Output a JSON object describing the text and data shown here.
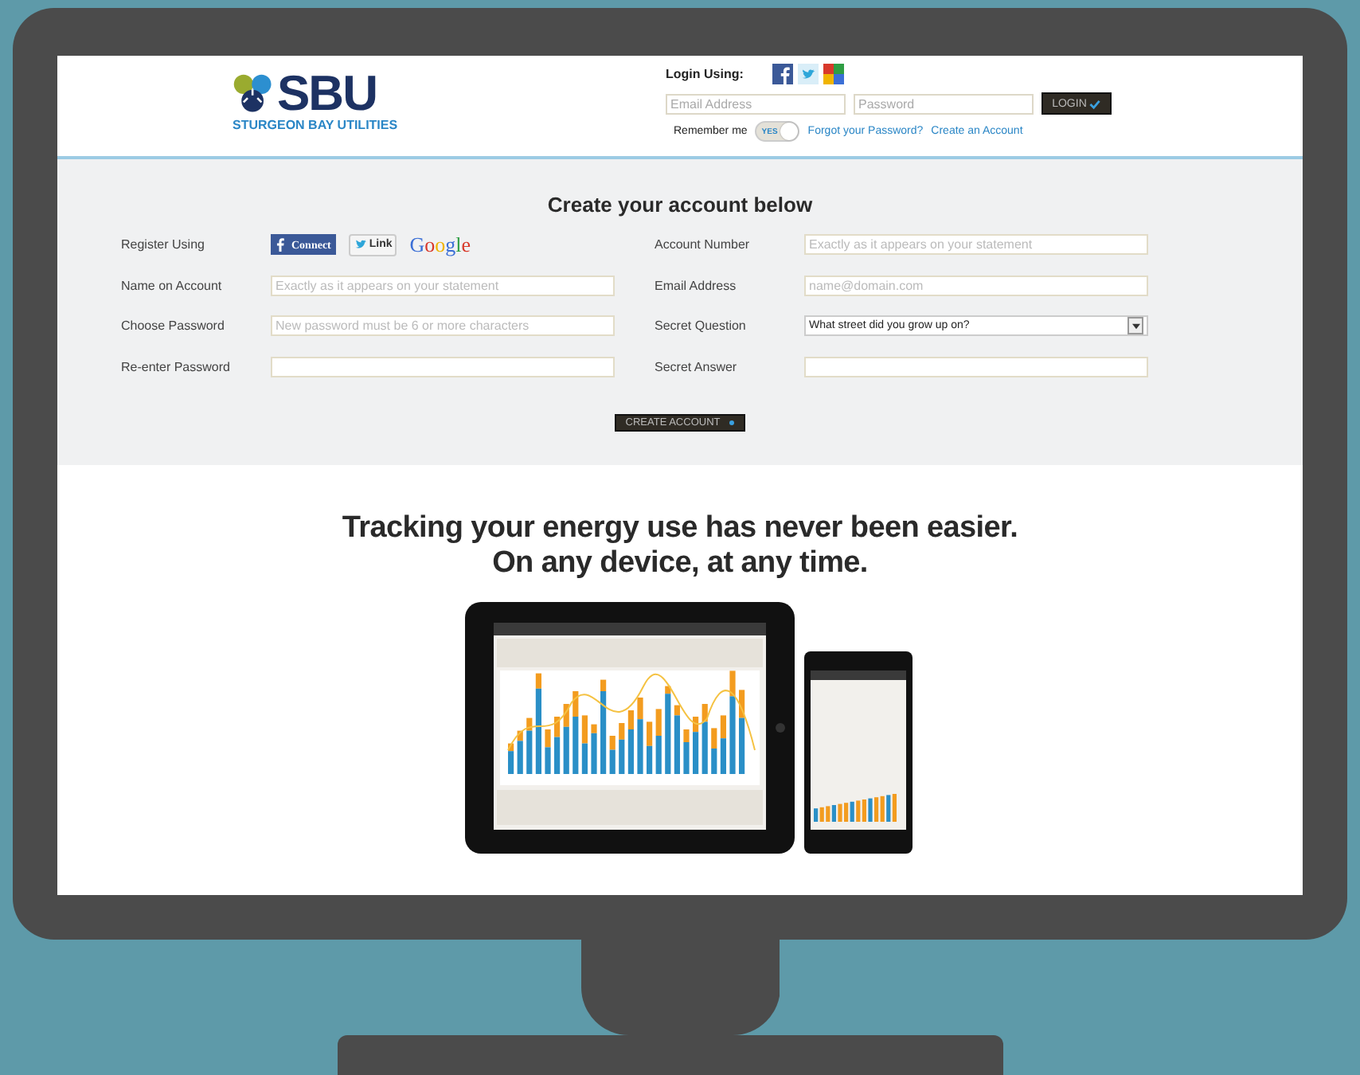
{
  "logo": {
    "wordmark": "SBU",
    "tagline": "STURGEON BAY UTILITIES"
  },
  "login": {
    "label": "Login Using:",
    "email_placeholder": "Email Address",
    "password_placeholder": "Password",
    "button": "LOGIN",
    "remember_label": "Remember me",
    "remember_toggle": {
      "on": true,
      "text": "YES"
    },
    "links": [
      "Forgot your Password?",
      "Create an Account"
    ]
  },
  "register": {
    "title": "Create your account below",
    "social_label": "Register Using",
    "social_buttons": [
      {
        "kind": "facebook",
        "label": "Connect"
      },
      {
        "kind": "twitter",
        "label": "Link"
      },
      {
        "kind": "google",
        "label": "Google"
      }
    ],
    "left_fields": [
      {
        "label": "Name on Account",
        "kind": "text",
        "placeholder": "Exactly as it appears on your statement"
      },
      {
        "label": "Choose Password",
        "kind": "text",
        "placeholder": "New password must be 6 or more characters"
      },
      {
        "label": "Re-enter Password",
        "kind": "text"
      }
    ],
    "right_fields": [
      {
        "label": "Account Number",
        "kind": "text",
        "placeholder": "Exactly as it appears on your statement"
      },
      {
        "label": "Email Address",
        "kind": "text",
        "placeholder": "name@domain.com"
      },
      {
        "label": "Secret Question",
        "kind": "select",
        "value": "What street did you grow up on?"
      },
      {
        "label": "Secret Answer",
        "kind": "text"
      }
    ],
    "button": "CREATE ACCOUNT"
  },
  "promo": {
    "headline": [
      "Tracking your energy use has never been easier.",
      "On any device, at any time."
    ]
  }
}
